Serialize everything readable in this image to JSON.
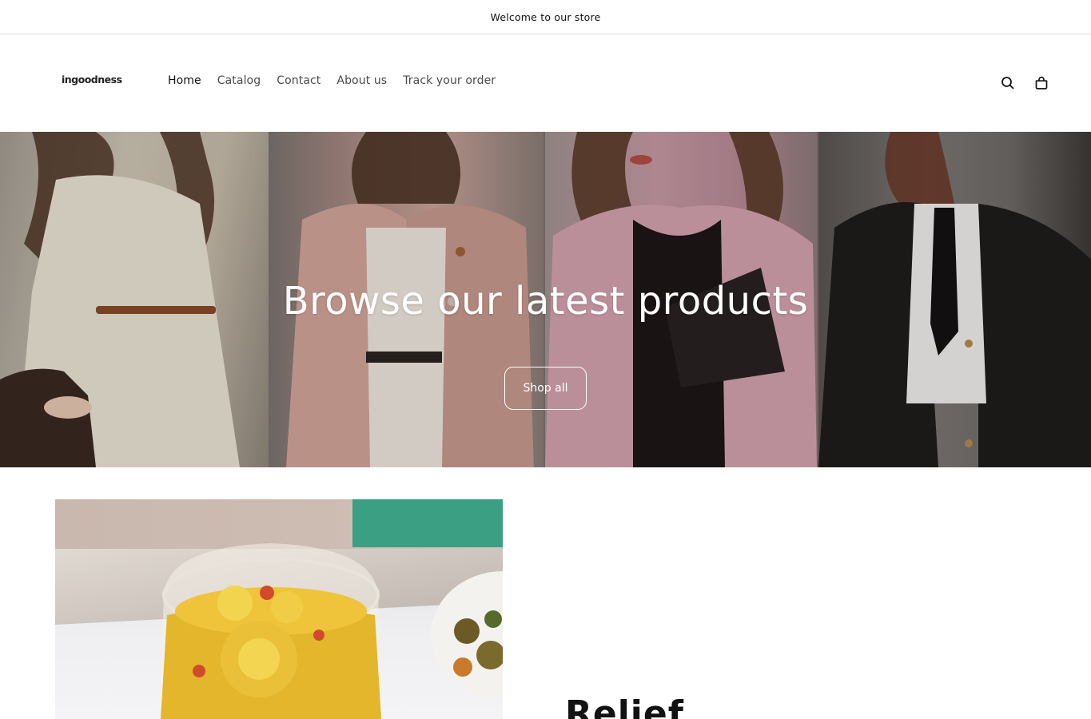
{
  "announcement": {
    "text": "Welcome to our store"
  },
  "header": {
    "logo_text": "ingoodness",
    "nav": [
      {
        "label": "Home",
        "active": true
      },
      {
        "label": "Catalog",
        "active": false
      },
      {
        "label": "Contact",
        "active": false
      },
      {
        "label": "About us",
        "active": false
      },
      {
        "label": "Track your order",
        "active": false
      }
    ],
    "icons": {
      "search": "search-icon",
      "cart": "cart-icon"
    }
  },
  "hero": {
    "title": "Browse our latest products",
    "button_label": "Shop all",
    "images": [
      "cream-blouse-model",
      "pink-blazer-model",
      "pink-fleece-jacket-model",
      "black-coat-tie-model"
    ]
  },
  "feature": {
    "image": "flower-tea-glass",
    "title": "Relief"
  },
  "colors": {
    "text": "#121212",
    "nav_inactive": "#4a4a4a",
    "border": "#e3e3e3",
    "teal": "#3b9f84"
  }
}
